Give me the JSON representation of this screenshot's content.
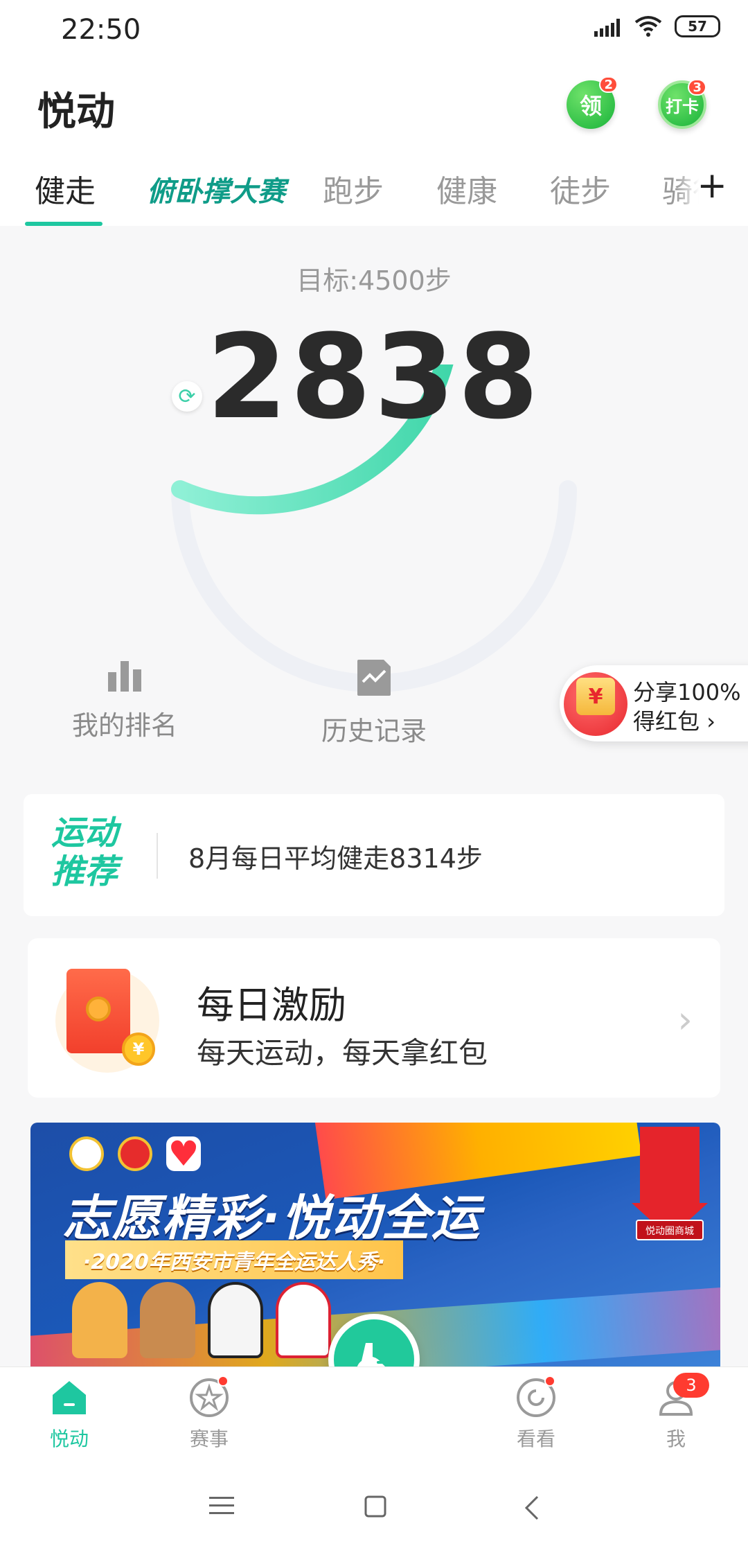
{
  "status_bar": {
    "time": "22:50",
    "battery": "57"
  },
  "header": {
    "title": "悦动",
    "receive_label": "领",
    "receive_badge": "2",
    "checkin_label": "打卡",
    "checkin_badge": "3"
  },
  "tabs": [
    "健走",
    "俯卧撑大赛",
    "跑步",
    "健康",
    "徒步",
    "骑行"
  ],
  "active_tab": "健走",
  "steps": {
    "goal_text": "目标:4500步",
    "count": "2838",
    "goal_value": 4500,
    "current_value": 2838
  },
  "quick_actions": {
    "rank": "我的排名",
    "history": "历史记录"
  },
  "share": {
    "line1": "分享100%",
    "line2": "得红包",
    "chevron": "›",
    "yen": "¥"
  },
  "recommend": {
    "title_line1": "运动",
    "title_line2": "推荐",
    "text": "8月每日平均健走8314步"
  },
  "daily": {
    "title": "每日激励",
    "subtitle": "每天运动，每天拿红包",
    "coin": "¥",
    "chevron": "›"
  },
  "banner": {
    "title": "志愿精彩·悦动全运",
    "subtitle": "·2020年西安市青年全运达人秀·",
    "mall_tag": "悦动圈商城"
  },
  "bottom_nav": {
    "home": "悦动",
    "events": "赛事",
    "watch": "看看",
    "me": "我",
    "me_badge": "3"
  },
  "colors": {
    "accent": "#1ec7a0",
    "badge": "#ff3b30"
  }
}
